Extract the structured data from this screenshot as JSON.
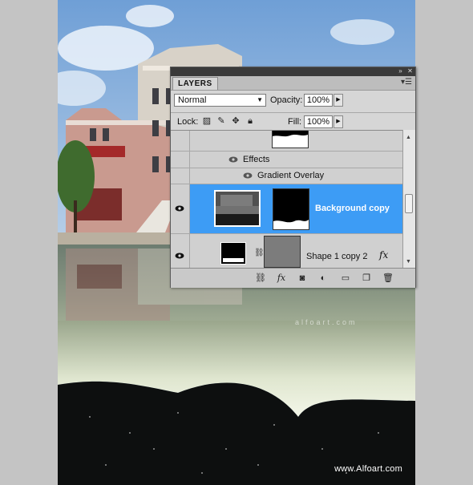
{
  "canvas": {
    "watermark": "www.Alfoart.com",
    "reflection_watermark": "alfoart.com"
  },
  "panel": {
    "tab_title": "LAYERS",
    "blend_mode": "Normal",
    "opacity_label": "Opacity:",
    "opacity_value": "100%",
    "lock_label": "Lock:",
    "fill_label": "Fill:",
    "fill_value": "100%",
    "layers": {
      "effects_label": "Effects",
      "gradient_overlay_label": "Gradient Overlay",
      "selected_layer_name": "Background copy",
      "shape_layer_name": "Shape 1 copy 2"
    }
  },
  "colors": {
    "selection": "#3d9cf5",
    "panel_bg": "#d6d6d6",
    "canvas_bg": "#c4c4c4"
  }
}
